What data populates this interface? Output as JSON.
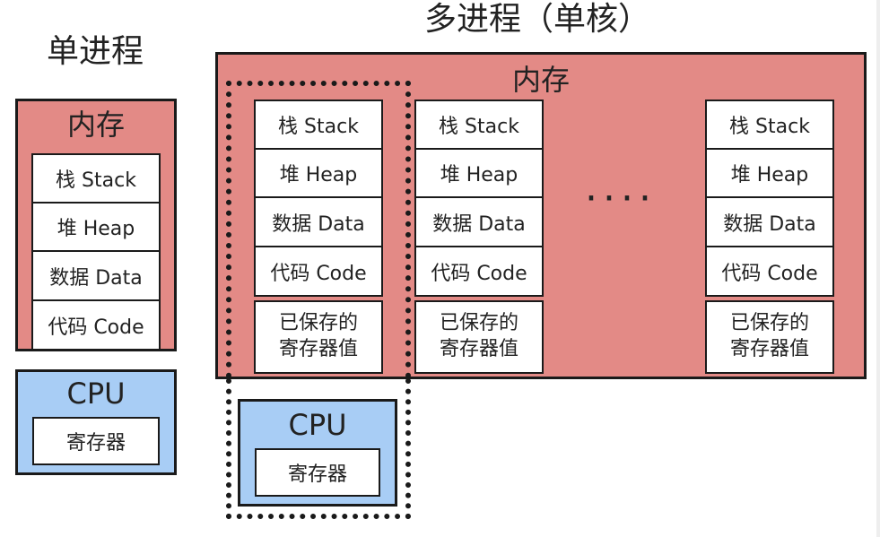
{
  "single": {
    "title": "单进程",
    "memory_label": "内存",
    "segments": [
      "栈 Stack",
      "堆 Heap",
      "数据 Data",
      "代码 Code"
    ],
    "cpu_label": "CPU",
    "register_label": "寄存器"
  },
  "multi": {
    "title": "多进程（单核）",
    "memory_label": "内存",
    "processes": [
      {
        "segments": [
          "栈 Stack",
          "堆 Heap",
          "数据 Data",
          "代码 Code"
        ],
        "saved": [
          "已保存的",
          "寄存器值"
        ]
      },
      {
        "segments": [
          "栈 Stack",
          "堆 Heap",
          "数据 Data",
          "代码 Code"
        ],
        "saved": [
          "已保存的",
          "寄存器值"
        ]
      },
      {
        "segments": [
          "栈 Stack",
          "堆 Heap",
          "数据 Data",
          "代码 Code"
        ],
        "saved": [
          "已保存的",
          "寄存器值"
        ]
      }
    ],
    "ellipsis": "····",
    "cpu_label": "CPU",
    "register_label": "寄存器"
  },
  "colors": {
    "memory": "#e38a86",
    "cpu": "#a8cdf5",
    "border": "#1a1a1a"
  }
}
